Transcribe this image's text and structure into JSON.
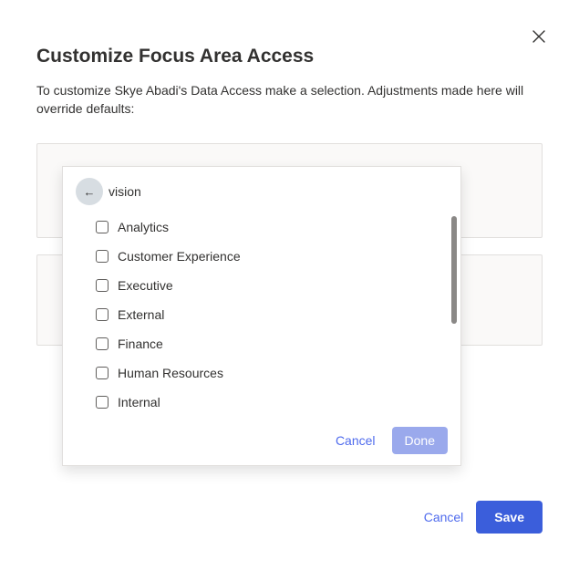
{
  "dialog": {
    "title": "Customize Focus Area Access",
    "description": "To customize Skye Abadi's Data Access make a selection. Adjustments made here will override defaults:"
  },
  "dropdown": {
    "header_label": "vision",
    "items": [
      {
        "label": "Analytics"
      },
      {
        "label": "Customer Experience"
      },
      {
        "label": "Executive"
      },
      {
        "label": "External"
      },
      {
        "label": "Finance"
      },
      {
        "label": "Human Resources"
      },
      {
        "label": "Internal"
      }
    ],
    "cancel_label": "Cancel",
    "done_label": "Done"
  },
  "footer": {
    "cancel_label": "Cancel",
    "save_label": "Save"
  }
}
